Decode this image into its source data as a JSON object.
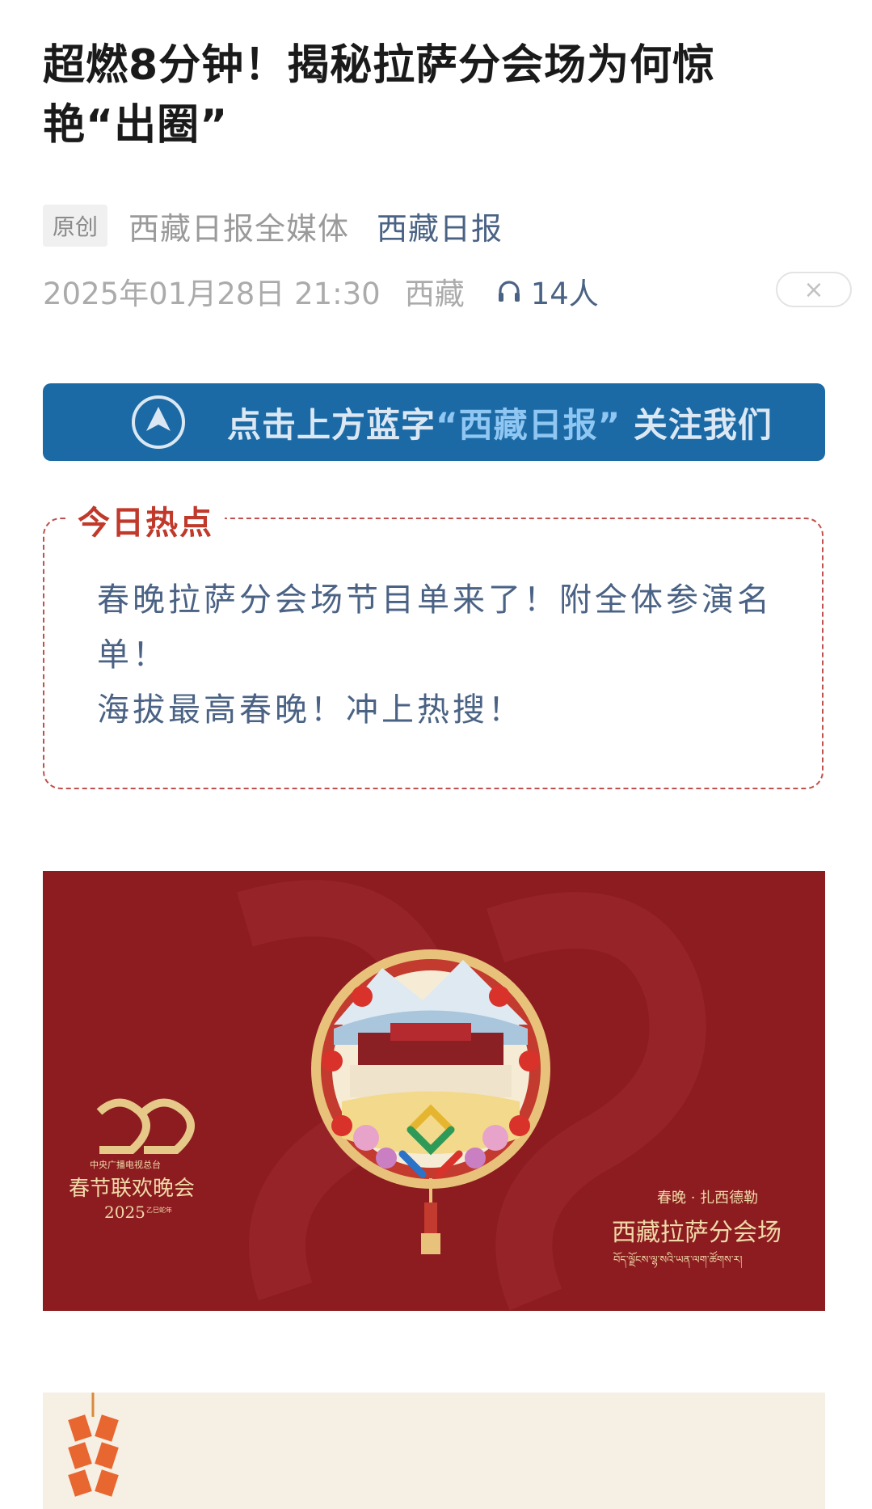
{
  "article": {
    "title_line1": "超燃8分钟！揭秘拉萨分会场为何惊",
    "title_line2": "艳“出圈”"
  },
  "meta": {
    "badge": "原创",
    "source": "西藏日报全媒体",
    "account": "西藏日报",
    "datetime": "2025年01月28日 21:30",
    "region": "西藏",
    "listeners": "14人",
    "close_icon": "×"
  },
  "follow_banner": {
    "prefix": "点击上方蓝字",
    "highlight": "“西藏日报”",
    "suffix": "关注我们"
  },
  "hot": {
    "title": "今日热点",
    "items": [
      "春晚拉萨分会场节目单来了！附全体参演名单！",
      "海拔最高春晚！冲上热搜！"
    ]
  },
  "poster": {
    "broadcaster": "中央广播电视总台",
    "gala": "春节联欢晚会",
    "year": "2025",
    "year_suffix": "乙巳蛇年",
    "tag": "春晚 · 扎西德勒",
    "venue": "西藏拉萨分会场",
    "tibetan": "བོད་ལྗོངས་ལྷ་སའི་ཡན་ལག་ཚོགས་ར།"
  },
  "colors": {
    "account_blue": "#4a6284",
    "banner_blue": "#1b6aa6",
    "hot_red": "#c0392b",
    "poster_red": "#8c1c20"
  }
}
